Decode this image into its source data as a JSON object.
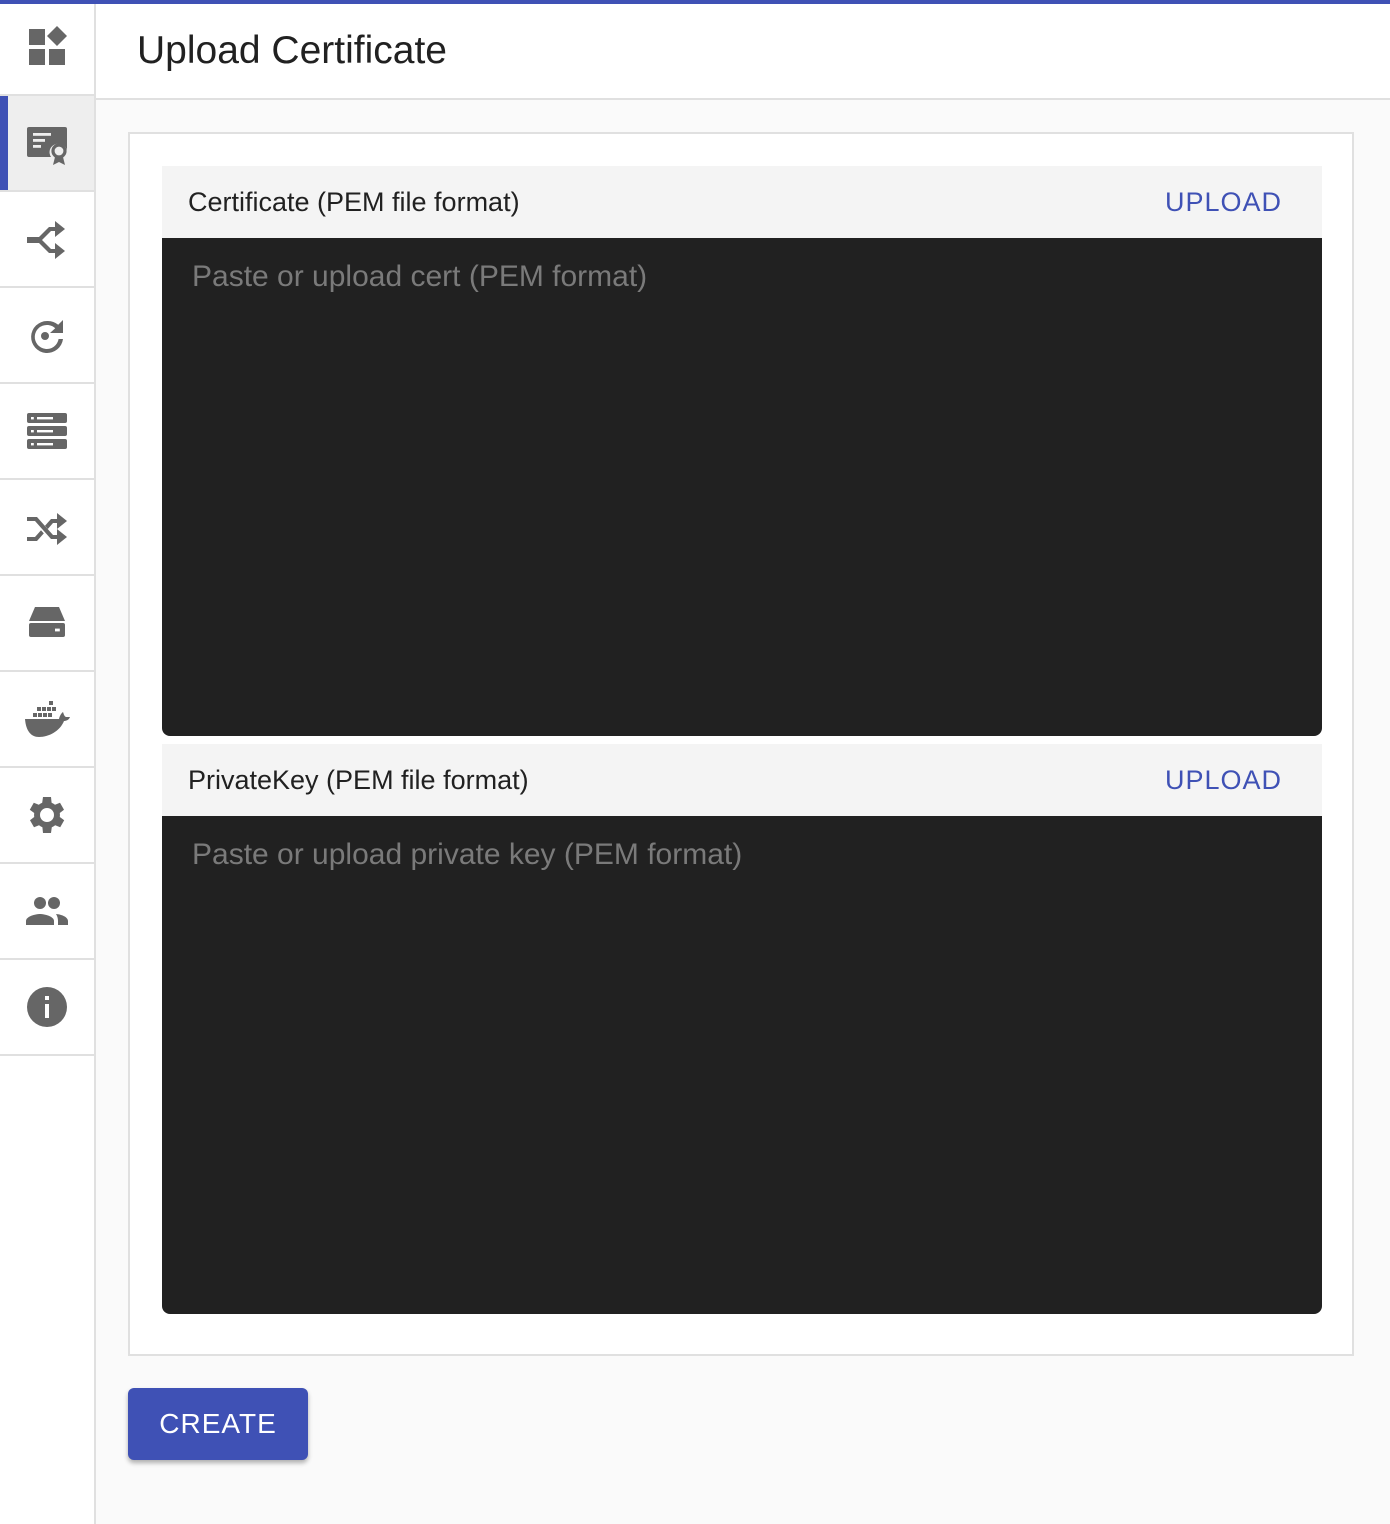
{
  "header": {
    "title": "Upload Certificate"
  },
  "sidebar": {
    "items": [
      {
        "name": "dashboard",
        "icon": "dashboard-icon",
        "active": false
      },
      {
        "name": "certificates",
        "icon": "certificate-icon",
        "active": true
      },
      {
        "name": "routes",
        "icon": "merge-arrows-icon",
        "active": false
      },
      {
        "name": "redirects",
        "icon": "rotate-right-icon",
        "active": false
      },
      {
        "name": "servers",
        "icon": "server-icon",
        "active": false
      },
      {
        "name": "load-balancing",
        "icon": "shuffle-icon",
        "active": false
      },
      {
        "name": "storage",
        "icon": "hard-drive-icon",
        "active": false
      },
      {
        "name": "docker",
        "icon": "docker-whale-icon",
        "active": false
      },
      {
        "name": "settings",
        "icon": "gear-icon",
        "active": false
      },
      {
        "name": "users",
        "icon": "people-icon",
        "active": false
      },
      {
        "name": "info",
        "icon": "info-icon",
        "active": false
      }
    ]
  },
  "form": {
    "certificate": {
      "label": "Certificate (PEM file format)",
      "upload_label": "UPLOAD",
      "placeholder": "Paste or upload cert (PEM format)",
      "value": ""
    },
    "private_key": {
      "label": "PrivateKey (PEM file format)",
      "upload_label": "UPLOAD",
      "placeholder": "Paste or upload private key (PEM format)",
      "value": ""
    },
    "create_label": "CREATE"
  },
  "colors": {
    "accent": "#3f51b5",
    "editor_bg": "#212121",
    "icon": "#666666"
  }
}
